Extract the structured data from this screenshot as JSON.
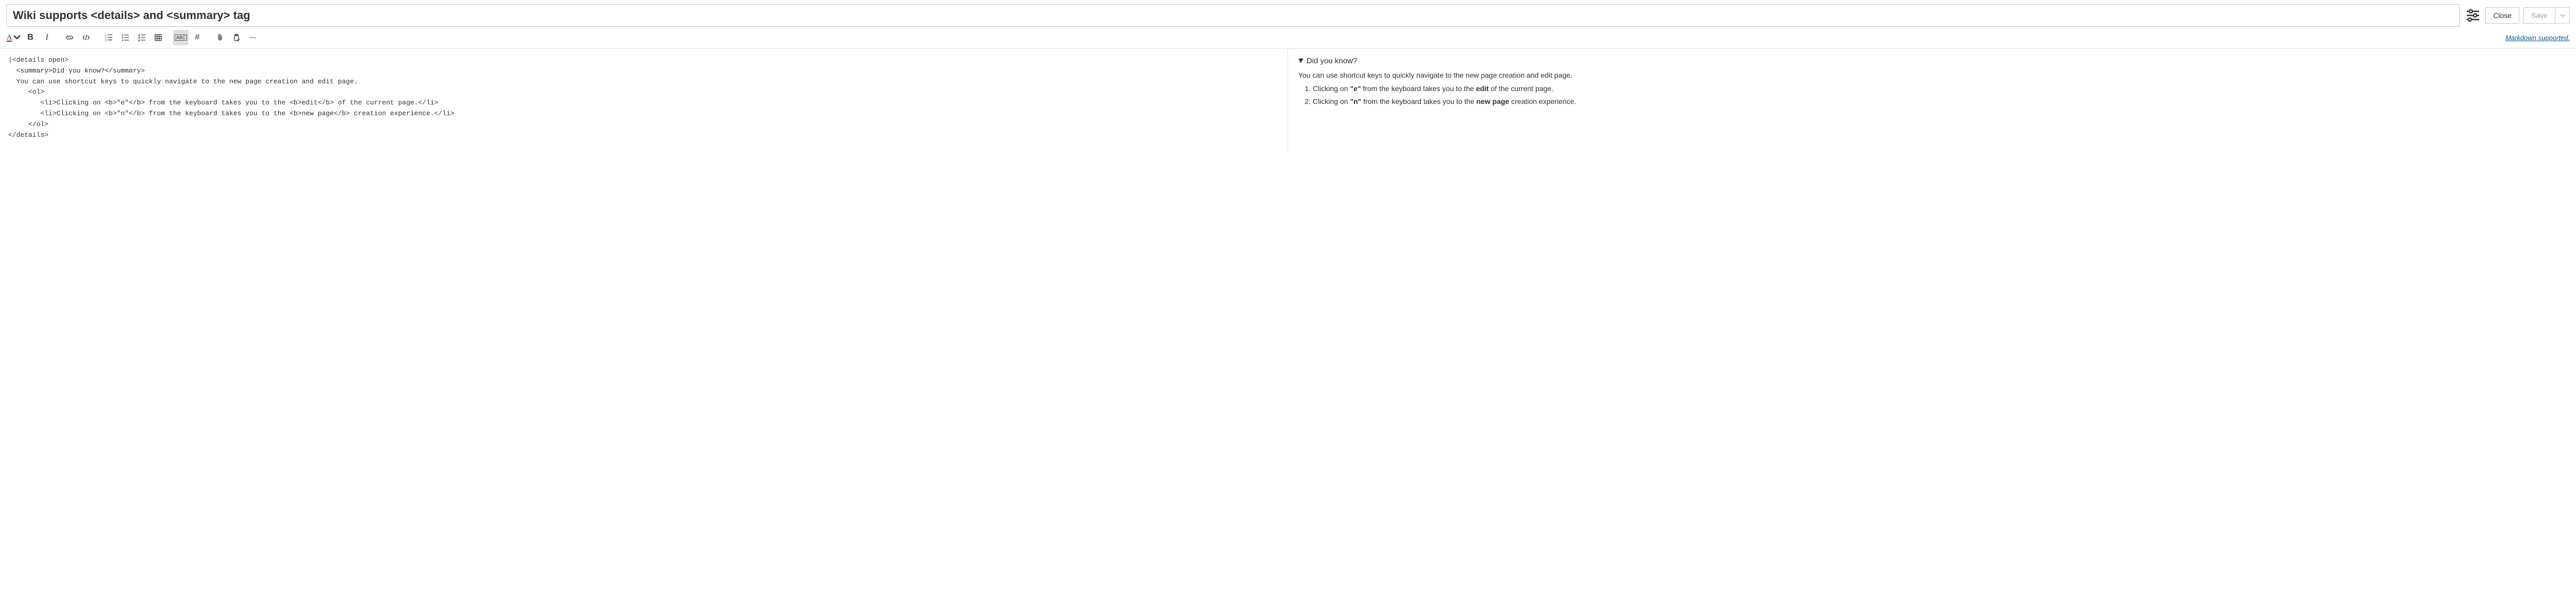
{
  "header": {
    "title_value": "Wiki supports <details> and <summary> tag",
    "close_label": "Close",
    "save_label": "Save"
  },
  "toolbar": {
    "markdown_link_label": "Markdown supported."
  },
  "editor": {
    "source_lines": [
      "|<details open>",
      "  <summary>Did you know?</summary>",
      "  You can use shortcut keys to quickly navigate to the new page creation and edit page.",
      "     <ol>",
      "        <li>Clicking on <b>\"e\"</b> from the keyboard takes you to the <b>edit</b> of the current page.</li>",
      "        <li>Clicking on <b>\"n\"</b> from the keyboard takes you to the <b>new page</b> creation experience.</li>",
      "     </ol>",
      "</details>"
    ]
  },
  "preview": {
    "summary_text": "Did you know?",
    "description": "You can use shortcut keys to quickly navigate to the new page creation and edit page.",
    "item1_prefix": "Clicking on ",
    "item1_key": "\"e\"",
    "item1_mid": " from the keyboard takes you to the ",
    "item1_bold": "edit",
    "item1_suffix": " of the current page.",
    "item2_prefix": "Clicking on ",
    "item2_key": "\"n\"",
    "item2_mid": " from the keyboard takes you to the ",
    "item2_bold": "new page",
    "item2_suffix": " creation experience."
  }
}
